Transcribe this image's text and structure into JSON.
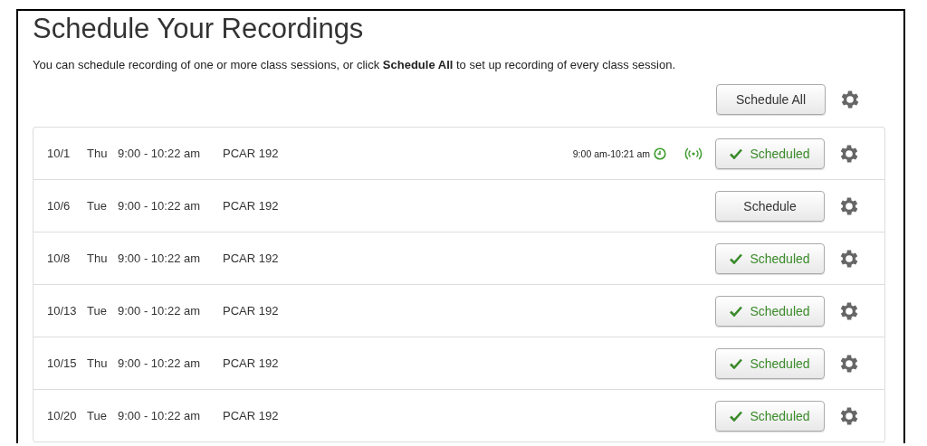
{
  "title": "Schedule Your Recordings",
  "intro": "You can schedule recording of one or more class sessions, or click **Schedule All** to set up recording of every class session.",
  "schedule_all_button": "Schedule All",
  "sessions": [
    {
      "date": "10/1",
      "day": "Thu",
      "time": "9:00 - 10:22 am",
      "room": "PCAR 192",
      "live_time": "9:00 am-10:21 am",
      "live": true,
      "scheduled": true,
      "button": "Scheduled"
    },
    {
      "date": "10/6",
      "day": "Tue",
      "time": "9:00 - 10:22 am",
      "room": "PCAR 192",
      "live": false,
      "scheduled": false,
      "button": "Schedule"
    },
    {
      "date": "10/8",
      "day": "Thu",
      "time": "9:00 - 10:22 am",
      "room": "PCAR 192",
      "live": false,
      "scheduled": true,
      "button": "Scheduled"
    },
    {
      "date": "10/13",
      "day": "Tue",
      "time": "9:00 - 10:22 am",
      "room": "PCAR 192",
      "live": false,
      "scheduled": true,
      "button": "Scheduled"
    },
    {
      "date": "10/15",
      "day": "Thu",
      "time": "9:00 - 10:22 am",
      "room": "PCAR 192",
      "live": false,
      "scheduled": true,
      "button": "Scheduled"
    },
    {
      "date": "10/20",
      "day": "Tue",
      "time": "9:00 - 10:22 am",
      "room": "PCAR 192",
      "live": false,
      "scheduled": true,
      "button": "Scheduled"
    }
  ]
}
